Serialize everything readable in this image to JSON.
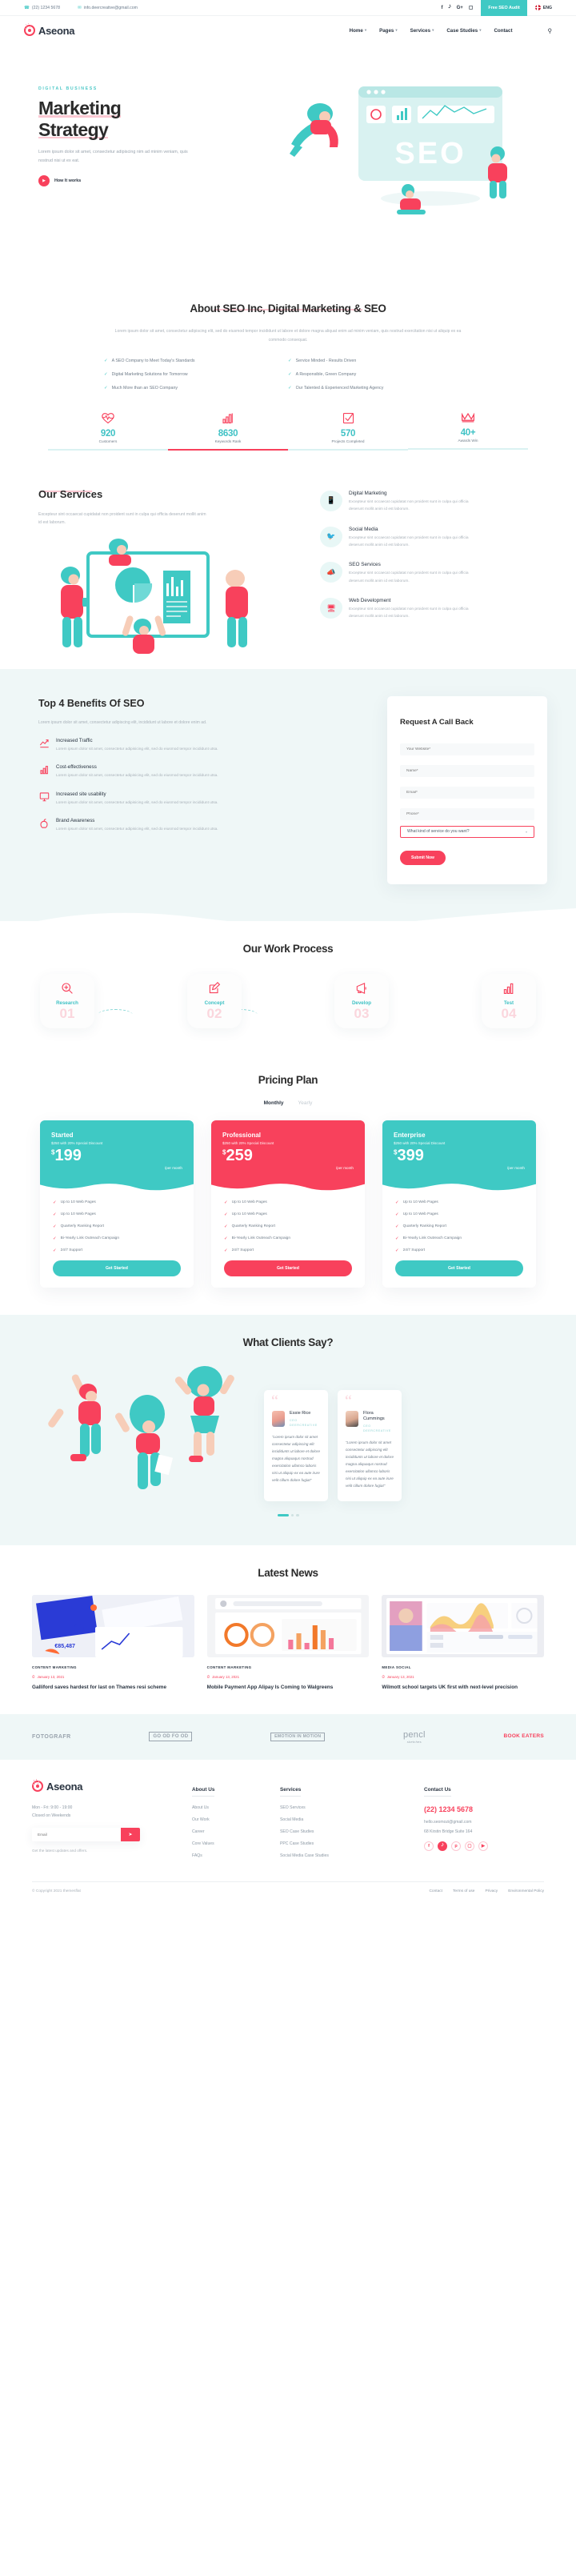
{
  "topbar": {
    "phone": "(22) 1234 5678",
    "email": "info.deercreative@gmail.com",
    "social": [
      "f",
      "t",
      "g",
      "i"
    ],
    "audit_button": "Free SEO Audit",
    "language": "ENG"
  },
  "nav": {
    "brand": "Aseona",
    "items": [
      {
        "label": "Home",
        "has_caret": true
      },
      {
        "label": "Pages",
        "has_caret": true
      },
      {
        "label": "Services",
        "has_caret": true
      },
      {
        "label": "Case Studies",
        "has_caret": true
      },
      {
        "label": "Contact",
        "has_caret": false
      }
    ],
    "search_icon": "search-icon"
  },
  "hero": {
    "eyebrow": "DIGITAL BUSINESS",
    "title_line1": "Marketing",
    "title_line2": "Strategy",
    "paragraph": "Lorem ipsum dolor sit amet, consectetur adipiscing nim ad minim veniam, quis nostrud nisi ut ex eat.",
    "cta_label": "How It works",
    "art_text": "SEO"
  },
  "about": {
    "title": "About SEO Inc, Digital Marketing & SEO",
    "paragraph": "Lorem ipsum dolor sit amet, consectetur adipiscing elit, sed do eiusmod tempor incididunt ut labore et dolore magna aliquat enim ad minim veniam, quis nostrud exercitation nisi ut aliquip ex ea commodo consequat.",
    "items": [
      "A SEO Company to Meet Today's Standards",
      "Service Minded - Results Driven",
      "Digital Marketing Solutions for Tomorrow",
      "A Responsible, Green Company",
      "Much More than an SEO Company",
      "Our Talented & Experienced Marketing Agency"
    ]
  },
  "stats": [
    {
      "icon": "heartbeat-icon",
      "value": "920",
      "label": "Customers",
      "active": false
    },
    {
      "icon": "bar-chart-icon",
      "value": "8630",
      "label": "Keywords Rank",
      "active": true
    },
    {
      "icon": "checkbox-icon",
      "value": "570",
      "label": "Projects Completed",
      "active": false
    },
    {
      "icon": "crown-icon",
      "value": "40+",
      "label": "Awards Win",
      "active": false
    }
  ],
  "services": {
    "title": "Our Services",
    "paragraph": "Excepteur sint occaecat cupidatat non proident sunt in culpa qui officia deserunt mollit anim id est laborum.",
    "items": [
      {
        "icon": "mobile-icon",
        "title": "Digital Marketing",
        "desc": "Excepteur sint occaecat cupidatat non proident sunt in culpa qui officia deserunt mollit anim id est laborum."
      },
      {
        "icon": "twitter-bird-icon",
        "title": "Social Media",
        "desc": "Excepteur sint occaecat cupidatat non proident sunt in culpa qui officia deserunt mollit anim id est laborum."
      },
      {
        "icon": "megaphone-icon",
        "title": "SEO Services",
        "desc": "Excepteur sint occaecat cupidatat non proident sunt in culpa qui officia deserunt mollit anim id est laborum."
      },
      {
        "icon": "monitor-icon",
        "title": "Web Development",
        "desc": "Excepteur sint occaecat cupidatat non proident sunt in culpa qui officia deserunt mollit anim id est laborum."
      }
    ]
  },
  "benefits": {
    "title": "Top 4 Benefits Of SEO",
    "paragraph": "Lorem ipsum dolor sit amet, consectetur adipiscing elit, incididunt ut labore et dolore enim ad.",
    "items": [
      {
        "icon": "trend-up-icon",
        "title": "Increased Traffic",
        "desc": "Lorem ipsum dolor sit amet, consectetur adipisicing elit, sed do eiusmod tempor incididunt utsa."
      },
      {
        "icon": "bar-chart-icon",
        "title": "Cost-effectiveness",
        "desc": "Lorem ipsum dolor sit amet, consectetur adipisicing elit, sed do eiusmod tempor incididunt utsa."
      },
      {
        "icon": "monitor-icon",
        "title": "Increased site usability",
        "desc": "Lorem ipsum dolor sit amet, consectetur adipisicing elit, sed do eiusmod tempor incididunt utsa."
      },
      {
        "icon": "apple-icon",
        "title": "Brand Awareness",
        "desc": "Lorem ipsum dolor sit amet, consectetur adipisicing elit, sed do eiusmod tempor incididunt utsa."
      }
    ]
  },
  "callback_form": {
    "title": "Request A Call Back",
    "fields": [
      {
        "name": "website",
        "placeholder": "Your Website*",
        "value": ""
      },
      {
        "name": "name",
        "placeholder": "Name*",
        "value": ""
      },
      {
        "name": "email",
        "placeholder": "Email*",
        "value": ""
      },
      {
        "name": "phone",
        "placeholder": "Phone*",
        "value": ""
      }
    ],
    "select_value": "What kind of service do you want?",
    "submit_label": "Submit Now"
  },
  "process": {
    "title": "Our Work Process",
    "steps": [
      {
        "icon": "search-plus-icon",
        "name": "Research",
        "number": "01"
      },
      {
        "icon": "pencil-edit-icon",
        "name": "Concept",
        "number": "02"
      },
      {
        "icon": "megaphone-icon",
        "name": "Develop",
        "number": "03"
      },
      {
        "icon": "bar-chart-icon",
        "name": "Test",
        "number": "04"
      }
    ]
  },
  "pricing": {
    "title": "Pricing Plan",
    "toggle": {
      "monthly": "Monthly",
      "yearly": "Yearly",
      "active": "Monthly"
    },
    "plans": [
      {
        "name": "Started",
        "discount": "$250 with 20% Special Discount",
        "currency": "$",
        "price": "199",
        "period": "/per month",
        "color": "teal",
        "features": [
          "Up to 10 Web Pages",
          "Up to 10 Web Pages",
          "Quarterly Ranking Report",
          "Bi-Yearly Link Outreach Campaign",
          "24/7 Support"
        ],
        "button": "Get Started"
      },
      {
        "name": "Professional",
        "discount": "$250 with 20% Special Discount",
        "currency": "$",
        "price": "259",
        "period": "/per month",
        "color": "pink",
        "features": [
          "Up to 10 Web Pages",
          "Up to 10 Web Pages",
          "Quarterly Ranking Report",
          "Bi-Yearly Link Outreach Campaign",
          "24/7 Support"
        ],
        "button": "Get Started"
      },
      {
        "name": "Enterprise",
        "discount": "$250 with 20% Special Discount",
        "currency": "$",
        "price": "399",
        "period": "/per month",
        "color": "teal",
        "features": [
          "Up to 10 Web Pages",
          "Up to 10 Web Pages",
          "Quarterly Ranking Report",
          "Bi-Yearly Link Outreach Campaign",
          "24/7 Support"
        ],
        "button": "Get Started"
      }
    ]
  },
  "testimonials": {
    "title": "What Clients Say?",
    "cards": [
      {
        "name": "Essie Rice",
        "role": "CEO",
        "org": "DEERCREATIVE",
        "quote": "“Lorem ipsum dolor sit amet consectetur adipiscing elit incididunts ut labore et dolore magna aliquaqus nostrud exercitation ullamco laboris nisi ut aliquip ex ea aute irure velit cillum dolore fugiat”"
      },
      {
        "name": "Flora Cummings",
        "role": "CEO",
        "org": "DEERCREATIVE",
        "quote": "“Lorem ipsum dolor sit amet consectetur adipiscing elit incididunts ut labore et dolore magna aliquaqus nostrud exercitation ullamco laboris nisi ut aliquip ex ea aute irure velit cillum dolore fugiat”"
      }
    ]
  },
  "news": {
    "title": "Latest News",
    "posts": [
      {
        "category": "CONTENT MARKETING",
        "date": "January 13, 2021",
        "title": "Galliford saves hardest for last on Thames resi scheme"
      },
      {
        "category": "CONTENT MARKETING",
        "date": "January 13, 2021",
        "title": "Mobile Payment App Alipay Is Coming to Walgreens"
      },
      {
        "category": "MEDIA SOCIAL",
        "date": "January 13, 2021",
        "title": "Wilmott school targets UK first with next-level precision"
      }
    ]
  },
  "brands": [
    {
      "name": "FOTOGRAFR",
      "style": "plain"
    },
    {
      "name": "GO OD FO OD",
      "style": "boxed"
    },
    {
      "name": "EMOTION IN MOTION",
      "style": "boxed"
    },
    {
      "name": "pencl",
      "sub": "sketches",
      "style": "script"
    },
    {
      "name": "BOOK EATERS",
      "style": "red"
    }
  ],
  "footer": {
    "brand": "Aseona",
    "hours_line1": "Mon - Fri: 9:00 - 19:00",
    "hours_line2": "Closed on Weekends",
    "email_placeholder": "Email",
    "subscribe_icon": "send-icon",
    "note": "Get the latest updates and offers.",
    "columns": [
      {
        "heading": "About Us",
        "links": [
          "About Us",
          "Our Work",
          "Career",
          "Core Values",
          "FAQs"
        ]
      },
      {
        "heading": "Services",
        "links": [
          "SEO Services",
          "Social Media",
          "SEO Case Studies",
          "PPC Case Studies",
          "Social Media Case Studies"
        ]
      }
    ],
    "contact": {
      "heading": "Contact Us",
      "phone": "(22) 1234 5678",
      "email": "hello.seomozi@gmail.com",
      "address": "68 Kirstin Bridge Suite 164",
      "social": [
        "f",
        "t",
        "p",
        "i",
        "y"
      ]
    },
    "copyright": "© Copyright 2021 themesflat",
    "bottom_links": [
      "Contact",
      "Terms of use",
      "Privacy",
      "Environmental Policy"
    ]
  },
  "colors": {
    "pink": "#f8415c",
    "teal": "#3fc9c4",
    "dark": "#2a3441",
    "muted": "#a9b1b9",
    "light_bg": "#eff7f7"
  }
}
